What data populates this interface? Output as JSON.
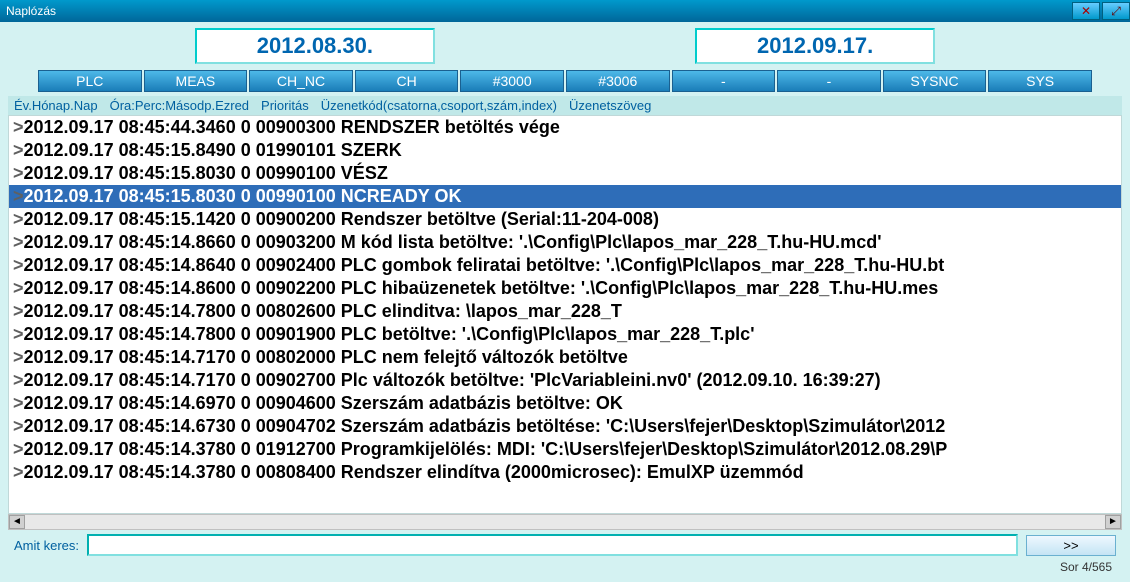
{
  "window": {
    "title": "Naplózás"
  },
  "dates": {
    "from": "2012.08.30.",
    "to": "2012.09.17."
  },
  "filters": [
    {
      "label": "PLC"
    },
    {
      "label": "MEAS"
    },
    {
      "label": "CH_NC"
    },
    {
      "label": "CH"
    },
    {
      "label": "#3000"
    },
    {
      "label": "#3006"
    },
    {
      "label": "-"
    },
    {
      "label": "-"
    },
    {
      "label": "SYSNC"
    },
    {
      "label": "SYS"
    }
  ],
  "columns": {
    "date": "Év.Hónap.Nap",
    "time": "Óra:Perc:Másodp.Ezred",
    "priority": "Prioritás",
    "code": "Üzenetkód(csatorna,csoport,szám,index)",
    "text": "Üzenetszöveg"
  },
  "log_rows": [
    {
      "sel": false,
      "text": "2012.09.17 08:45:44.3460 0 00900300 RENDSZER betöltés vége"
    },
    {
      "sel": false,
      "text": "2012.09.17 08:45:15.8490 0 01990101 SZERK"
    },
    {
      "sel": false,
      "text": "2012.09.17 08:45:15.8030 0 00990100 VÉSZ"
    },
    {
      "sel": true,
      "text": "2012.09.17 08:45:15.8030 0 00990100 NCREADY OK"
    },
    {
      "sel": false,
      "text": "2012.09.17 08:45:15.1420 0 00900200 Rendszer betöltve (Serial:11-204-008)"
    },
    {
      "sel": false,
      "text": "2012.09.17 08:45:14.8660 0 00903200 M kód lista betöltve: '.\\Config\\Plc\\lapos_mar_228_T.hu-HU.mcd'"
    },
    {
      "sel": false,
      "text": "2012.09.17 08:45:14.8640 0 00902400 PLC gombok feliratai betöltve: '.\\Config\\Plc\\lapos_mar_228_T.hu-HU.bt"
    },
    {
      "sel": false,
      "text": "2012.09.17 08:45:14.8600 0 00902200 PLC hibaüzenetek betöltve: '.\\Config\\Plc\\lapos_mar_228_T.hu-HU.mes"
    },
    {
      "sel": false,
      "text": "2012.09.17 08:45:14.7800 0 00802600 PLC elinditva: \\lapos_mar_228_T"
    },
    {
      "sel": false,
      "text": "2012.09.17 08:45:14.7800 0 00901900 PLC betöltve: '.\\Config\\Plc\\lapos_mar_228_T.plc'"
    },
    {
      "sel": false,
      "text": "2012.09.17 08:45:14.7170 0 00802000 PLC nem felejtő változók betöltve"
    },
    {
      "sel": false,
      "text": "2012.09.17 08:45:14.7170 0 00902700 Plc változók betöltve: 'PlcVariableini.nv0' (2012.09.10. 16:39:27)"
    },
    {
      "sel": false,
      "text": "2012.09.17 08:45:14.6970 0 00904600 Szerszám adatbázis betöltve: OK"
    },
    {
      "sel": false,
      "text": "2012.09.17 08:45:14.6730 0 00904702 Szerszám adatbázis betöltése: 'C:\\Users\\fejer\\Desktop\\Szimulátor\\2012"
    },
    {
      "sel": false,
      "text": "2012.09.17 08:45:14.3780 0 01912700 Programkijelölés: MDI: 'C:\\Users\\fejer\\Desktop\\Szimulátor\\2012.08.29\\P"
    },
    {
      "sel": false,
      "text": "2012.09.17 08:45:14.3780 0 00808400 Rendszer elindítva  (2000microsec): EmulXP üzemmód"
    }
  ],
  "search": {
    "label": "Amit keres:",
    "value": "",
    "next": ">>"
  },
  "status": {
    "text": "Sor 4/565"
  }
}
